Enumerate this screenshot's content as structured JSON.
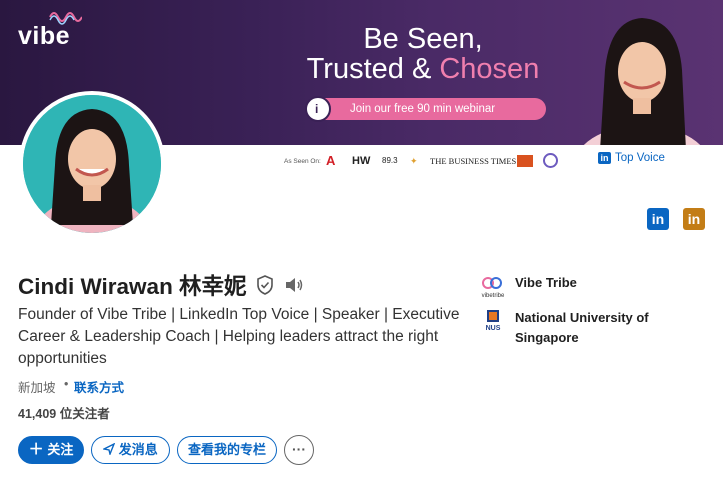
{
  "banner": {
    "logo_text": "vibe",
    "headline_line1": "Be Seen,",
    "headline_line2_start": "Trusted & ",
    "headline_line2_accent": "Chosen",
    "webinar_cta": "Join our free 90 min webinar",
    "as_seen_on": "As Seen On:",
    "media_logos": [
      "A",
      "HW",
      "89.3",
      "THE BUSINESS TIMES"
    ],
    "top_voice_badge": "Top Voice",
    "colors": {
      "banner_bg": "#3a2156",
      "accent_pink": "#f07fae",
      "cta_pink": "#e86a9e"
    }
  },
  "profile": {
    "name": "Cindi Wirawan 林幸妮",
    "headline": "Founder of Vibe Tribe | LinkedIn Top Voice | Speaker | Executive Career & Leadership Coach | Helping leaders attract the right opportunities",
    "location": "新加坡",
    "contact_info_separator": "•",
    "contact_info_link": "联系方式",
    "followers": "41,409 位关注者"
  },
  "organizations": [
    {
      "logo_text": "vibetribe",
      "name": "Vibe Tribe"
    },
    {
      "logo_text": "NUS",
      "name": "National University of Singapore"
    }
  ],
  "actions": {
    "follow": "关注",
    "message": "发消息",
    "newsletter": "查看我的专栏",
    "more": "···"
  },
  "icons": {
    "linkedin_badge_1": "in",
    "linkedin_badge_2": "in"
  },
  "colors": {
    "brand_blue": "#0a66c2",
    "gold": "#c37d16"
  }
}
